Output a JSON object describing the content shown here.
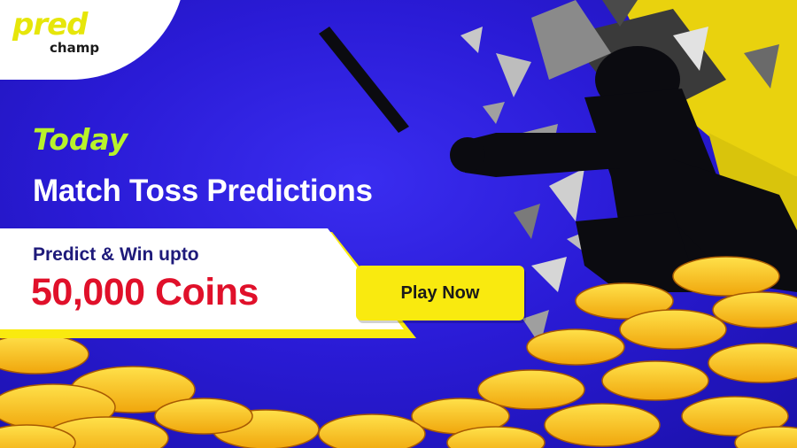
{
  "brand": {
    "name_top": "pred",
    "name_bottom": "champ"
  },
  "headline": {
    "eyebrow": "Today",
    "title": "Match Toss Predictions"
  },
  "offer": {
    "line1": "Predict & Win upto",
    "amount": "50,000 Coins"
  },
  "cta": {
    "label": "Play Now"
  },
  "colors": {
    "background": "#2a1bd6",
    "brand_yellow": "#f9ea0f",
    "lime": "#b8f22a",
    "amount_red": "#e0102a",
    "panel_white": "#ffffff"
  },
  "illustration": {
    "subject": "cricket-batsman-silhouette",
    "decor": "gold-coin-piles"
  }
}
